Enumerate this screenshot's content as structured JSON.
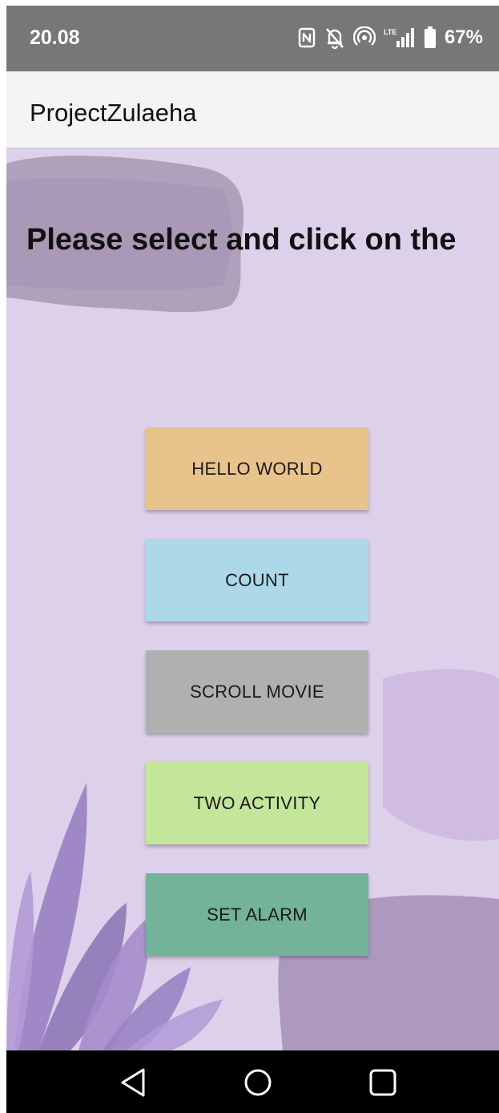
{
  "status_bar": {
    "time": "20.08",
    "battery": "67%",
    "network_label": "LTE",
    "icons": [
      "nfc-icon",
      "bell-off-icon",
      "hotspot-icon",
      "lte-signal-icon",
      "battery-icon"
    ]
  },
  "app_bar": {
    "title": "ProjectZulaeha"
  },
  "main": {
    "heading": "Please select and click on the",
    "buttons": [
      {
        "label": "HELLO WORLD",
        "color": "#e8c48c"
      },
      {
        "label": "COUNT",
        "color": "#acd8e8"
      },
      {
        "label": "SCROLL MOVIE",
        "color": "#b0b0b0"
      },
      {
        "label": "TWO ACTIVITY",
        "color": "#c4e69a"
      },
      {
        "label": "SET ALARM",
        "color": "#72b39a"
      }
    ]
  },
  "nav_bar": {
    "icons": [
      "back-icon",
      "home-icon",
      "recents-icon"
    ]
  },
  "colors": {
    "status_bar": "#777777",
    "app_bar": "#f4f4f4",
    "background": "#ddd0ea",
    "nav_bar": "#000000"
  }
}
